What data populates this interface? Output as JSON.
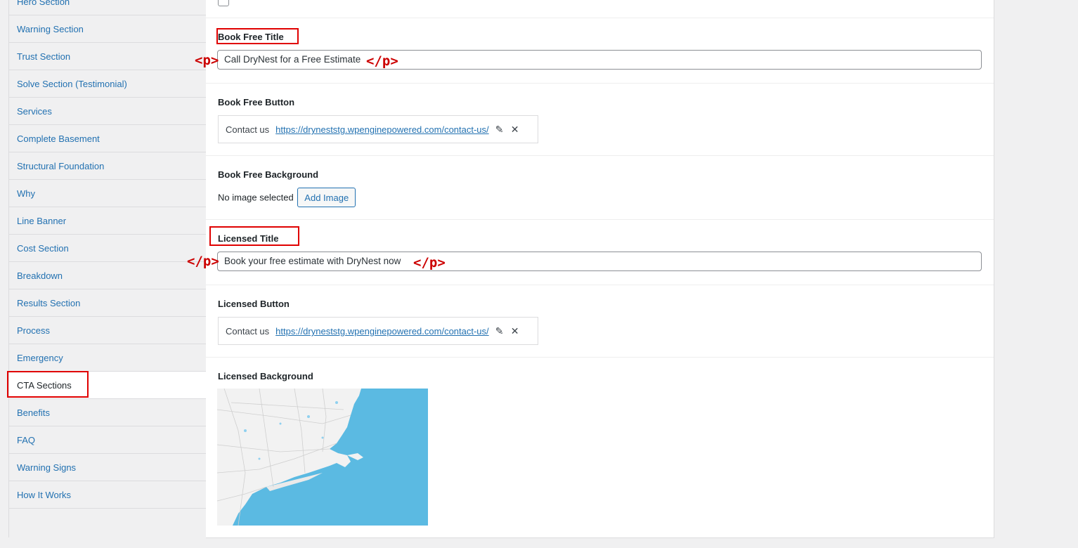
{
  "sidebar": {
    "items": [
      {
        "label": "Hero Section"
      },
      {
        "label": "Warning Section"
      },
      {
        "label": "Trust Section"
      },
      {
        "label": "Solve Section (Testimonial)"
      },
      {
        "label": "Services"
      },
      {
        "label": "Complete Basement"
      },
      {
        "label": "Structural Foundation"
      },
      {
        "label": "Why"
      },
      {
        "label": "Line Banner"
      },
      {
        "label": "Cost Section"
      },
      {
        "label": "Breakdown"
      },
      {
        "label": "Results Section"
      },
      {
        "label": "Process"
      },
      {
        "label": "Emergency"
      },
      {
        "label": "CTA Sections",
        "active": true
      },
      {
        "label": "Benefits"
      },
      {
        "label": "FAQ"
      },
      {
        "label": "Warning Signs"
      },
      {
        "label": "How It Works"
      }
    ]
  },
  "fields": {
    "book_free_title": {
      "label": "Book Free Title",
      "value": "Call DryNest for a Free Estimate"
    },
    "book_free_button": {
      "label": "Book Free Button",
      "link_title": "Contact us",
      "link_url": "https://dryneststg.wpenginepowered.com/contact-us/"
    },
    "book_free_background": {
      "label": "Book Free Background",
      "status": "No image selected",
      "button_label": "Add Image"
    },
    "licensed_title": {
      "label": "Licensed Title",
      "value": "Book your free estimate with DryNest now"
    },
    "licensed_button": {
      "label": "Licensed Button",
      "link_title": "Contact us",
      "link_url": "https://dryneststg.wpenginepowered.com/contact-us/"
    },
    "licensed_background": {
      "label": "Licensed Background"
    }
  },
  "annotations": {
    "open_p": "<p>",
    "close_p": "</p>"
  },
  "icons": {
    "edit": "pencil-icon",
    "remove": "close-icon"
  },
  "colors": {
    "link": "#2271b1",
    "annotation": "#e00000",
    "map_water": "#5bbae2"
  }
}
